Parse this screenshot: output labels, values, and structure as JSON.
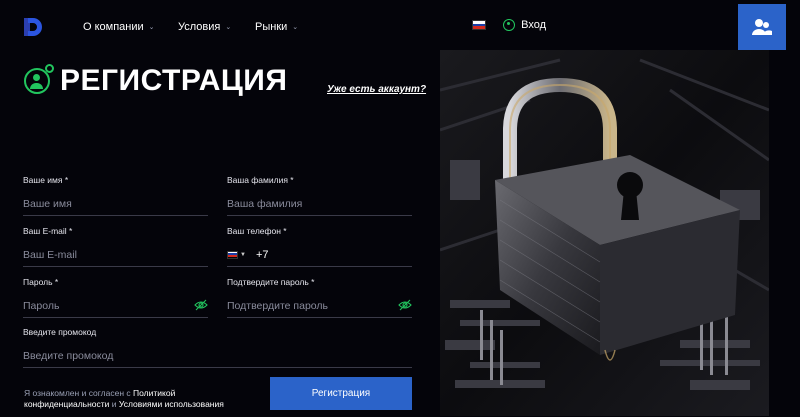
{
  "header": {
    "logo_letter": "D",
    "nav": [
      {
        "label": "О компании"
      },
      {
        "label": "Условия"
      },
      {
        "label": "Рынки"
      }
    ],
    "login_label": "Вход",
    "flag_colors": [
      "#ffffff",
      "#1c3fa8",
      "#d52b1e"
    ],
    "accent": "#2b63c9",
    "green": "#22c55e"
  },
  "page": {
    "title": "РЕГИСТРАЦИЯ",
    "have_account": "Уже есть аккаунт?"
  },
  "form": {
    "first_name": {
      "label": "Ваше имя *",
      "placeholder": "Ваше имя"
    },
    "last_name": {
      "label": "Ваша фамилия *",
      "placeholder": "Ваша фамилия"
    },
    "email": {
      "label": "Ваш E-mail *",
      "placeholder": "Ваш E-mail"
    },
    "phone": {
      "label": "Ваш телефон *",
      "code": "+7"
    },
    "password": {
      "label": "Пароль *",
      "placeholder": "Пароль"
    },
    "password_confirm": {
      "label": "Подтвердите пароль *",
      "placeholder": "Подтвердите пароль"
    },
    "promo": {
      "label": "Введите промокод",
      "placeholder": "Введите промокод"
    },
    "consent_prefix": "Я ознакомлен и согласен с",
    "privacy_link": "Политикой конфиденциальности",
    "consent_and": "и",
    "terms_link": "Условиями использования",
    "submit_label": "Регистрация"
  }
}
